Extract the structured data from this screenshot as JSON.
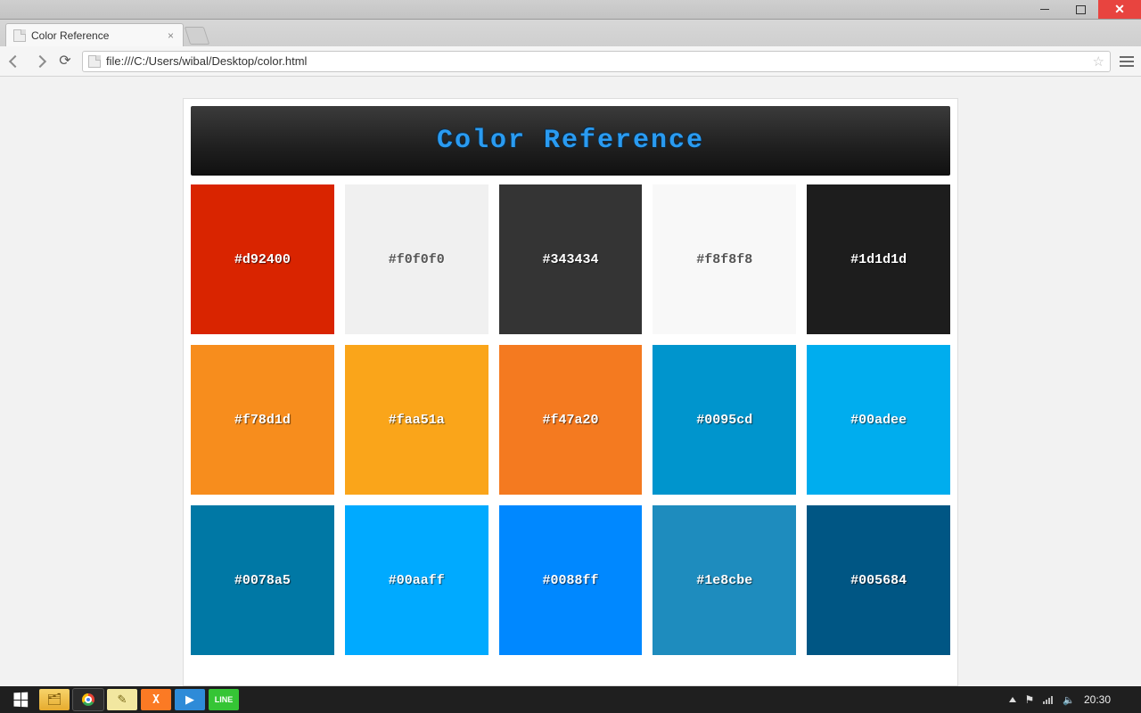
{
  "window": {
    "title": "Color Reference"
  },
  "browser": {
    "tab_title": "Color Reference",
    "url": "file:///C:/Users/wibal/Desktop/color.html"
  },
  "page": {
    "heading": "Color Reference",
    "swatches": [
      {
        "hex": "#d92400",
        "label": "#d92400",
        "text": "light"
      },
      {
        "hex": "#f0f0f0",
        "label": "#f0f0f0",
        "text": "dark"
      },
      {
        "hex": "#343434",
        "label": "#343434",
        "text": "light"
      },
      {
        "hex": "#f8f8f8",
        "label": "#f8f8f8",
        "text": "dark"
      },
      {
        "hex": "#1d1d1d",
        "label": "#1d1d1d",
        "text": "light"
      },
      {
        "hex": "#f78d1d",
        "label": "#f78d1d",
        "text": "light"
      },
      {
        "hex": "#faa51a",
        "label": "#faa51a",
        "text": "light"
      },
      {
        "hex": "#f47a20",
        "label": "#f47a20",
        "text": "light"
      },
      {
        "hex": "#0095cd",
        "label": "#0095cd",
        "text": "light"
      },
      {
        "hex": "#00adee",
        "label": "#00adee",
        "text": "light"
      },
      {
        "hex": "#0078a5",
        "label": "#0078a5",
        "text": "light"
      },
      {
        "hex": "#00aaff",
        "label": "#00aaff",
        "text": "light"
      },
      {
        "hex": "#0088ff",
        "label": "#0088ff",
        "text": "light"
      },
      {
        "hex": "#1e8cbe",
        "label": "#1e8cbe",
        "text": "light"
      },
      {
        "hex": "#005684",
        "label": "#005684",
        "text": "light"
      }
    ]
  },
  "taskbar": {
    "clock": "20:30",
    "apps": {
      "xampp": "X",
      "line": "LINE"
    }
  }
}
